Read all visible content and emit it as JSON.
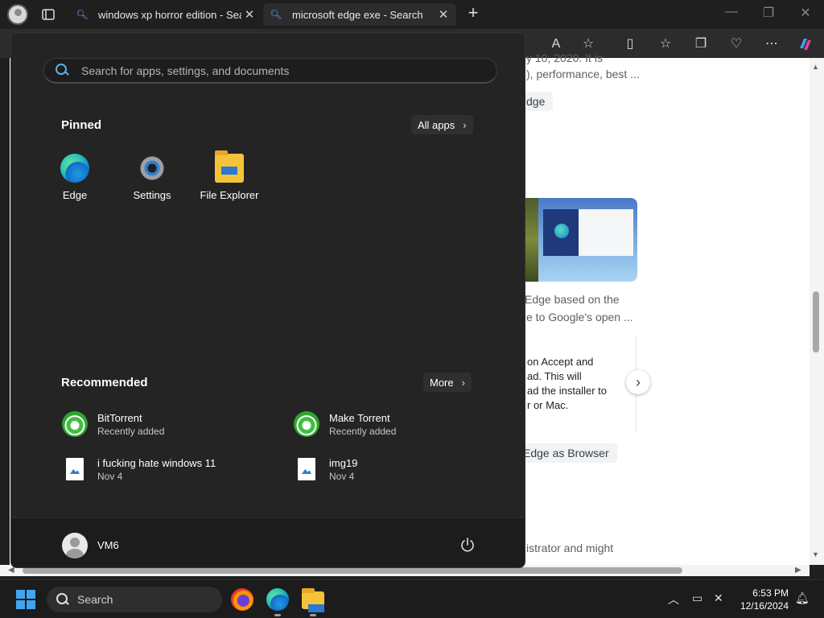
{
  "browser": {
    "tabs": [
      {
        "label": "windows xp horror edition - Search",
        "close": "✕"
      },
      {
        "label": "microsoft edge exe - Search",
        "close": "✕"
      }
    ],
    "new_tab": "+",
    "window_controls": {
      "minimize": "—",
      "restore": "❐",
      "close": "✕"
    }
  },
  "page": {
    "lines": [
      "y 10, 2020. It is",
      "), performance, best ...",
      "Edge based on the",
      "e to Google's open ...",
      "on Accept and",
      "ad. This will",
      "ad the installer to",
      "r or Mac.",
      "istrator and might"
    ],
    "chips": [
      "dge",
      "Edge as Browser"
    ],
    "next": "›"
  },
  "start_menu": {
    "search_placeholder": "Search for apps, settings, and documents",
    "pinned_title": "Pinned",
    "all_apps_label": "All apps",
    "pinned": [
      {
        "label": "Edge",
        "icon": "edge-icon"
      },
      {
        "label": "Settings",
        "icon": "settings-gear-icon"
      },
      {
        "label": "File Explorer",
        "icon": "folder-icon"
      }
    ],
    "recommended_title": "Recommended",
    "more_label": "More",
    "recommended": [
      {
        "name": "BitTorrent",
        "sub": "Recently added",
        "icon": "bittorrent-icon"
      },
      {
        "name": "Make Torrent",
        "sub": "Recently added",
        "icon": "bittorrent-icon"
      },
      {
        "name": "i fucking hate windows 11",
        "sub": "Nov 4",
        "icon": "image-file-icon"
      },
      {
        "name": "img19",
        "sub": "Nov 4",
        "icon": "image-file-icon"
      }
    ],
    "user_name": "VM6"
  },
  "taskbar": {
    "search_label": "Search",
    "time": "6:53 PM",
    "date": "12/16/2024"
  },
  "colors": {
    "start_bg": "#242424",
    "accent": "#3fa6f0",
    "taskbar_bg": "#1c1c1c"
  }
}
